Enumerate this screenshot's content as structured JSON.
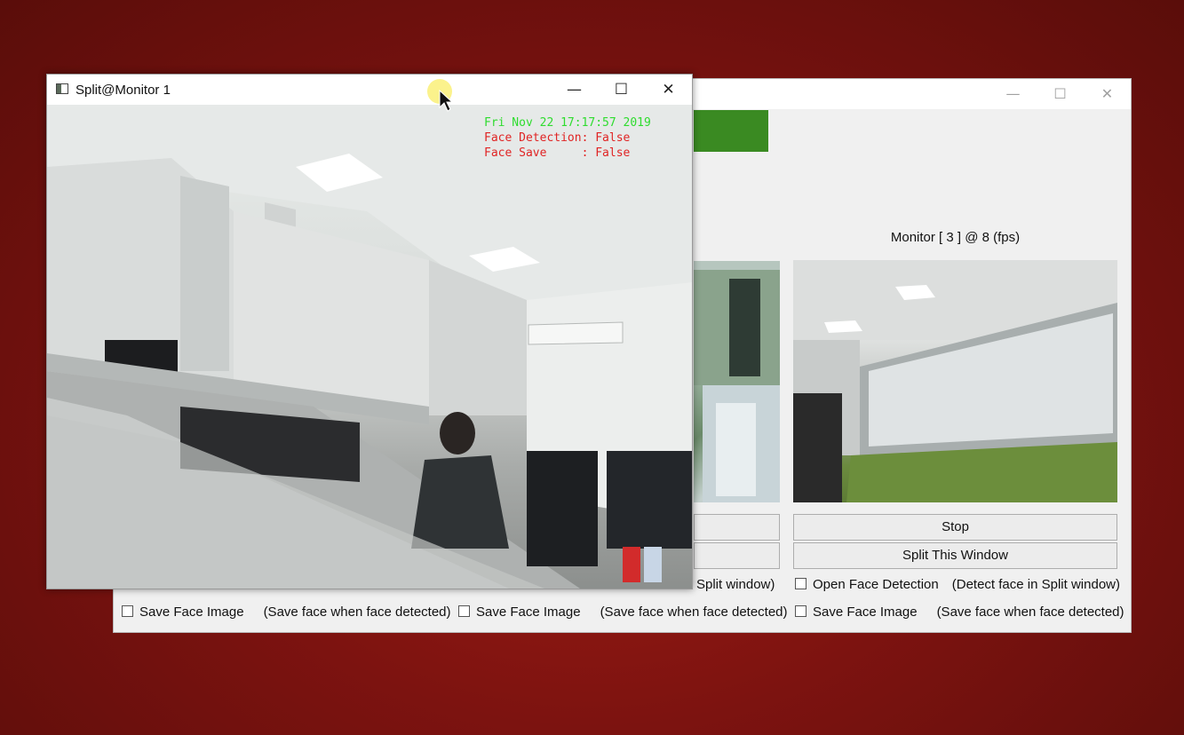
{
  "main_window": {
    "controls": {
      "minimize": "—",
      "maximize": "☐",
      "close": "✕"
    },
    "accent_color": "#3a8a22",
    "monitor3_label": "Monitor [ 3 ] @  8 (fps)",
    "stop_label": "Stop",
    "split_label": "Split This Window",
    "face_detect_partial_hint": "Split window)",
    "open_face_detection_label": "Open Face Detection",
    "open_face_detection_hint": "(Detect face in Split window)",
    "save_face_rows": [
      {
        "label": "Save Face Image",
        "hint": "(Save face when face detected)"
      },
      {
        "label": "Save Face Image",
        "hint": "(Save face when face detected)"
      },
      {
        "label": "Save Face Image",
        "hint": "(Save face when face detected)"
      }
    ]
  },
  "split_window": {
    "title": "Split@Monitor 1",
    "controls": {
      "minimize": "—",
      "maximize": "☐",
      "close": "✕"
    },
    "overlay": {
      "timestamp": "Fri Nov 22 17:17:57 2019",
      "face_detection": "Face Detection: False",
      "face_save": "Face Save     : False",
      "timestamp_color": "#2fdc2f",
      "status_color": "#e02424"
    }
  }
}
